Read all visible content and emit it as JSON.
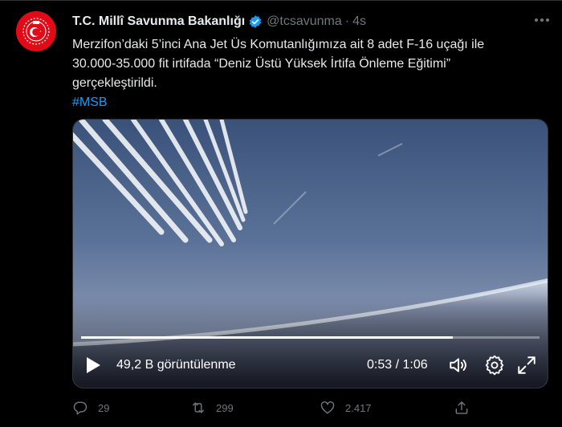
{
  "tweet": {
    "author_name": "T.C. Millî Savunma Bakanlığı",
    "handle": "@tcsavunma",
    "separator": "·",
    "time": "4s",
    "text_lines": [
      "Merzifon’daki 5’inci Ana Jet Üs Komutanlığımıza ait 8 adet F-16 uçağı ile",
      "30.000-35.000 fit irtifada “Deniz Üstü Yüksek İrtifa Önleme Eğitimi”",
      "gerçekleştirildi."
    ],
    "hashtag": "#MSB"
  },
  "video": {
    "views": "49,2 B görüntülenme",
    "time_display": "0:53 / 1:06",
    "progress_fraction": 0.81,
    "icons": [
      "play-icon",
      "volume-icon",
      "settings-icon",
      "fullscreen-icon"
    ]
  },
  "actions": {
    "reply_count": "29",
    "retweet_count": "299",
    "like_count": "2.417",
    "icons": [
      "reply-icon",
      "retweet-icon",
      "like-icon",
      "share-icon"
    ]
  },
  "colors": {
    "background": "#000000",
    "text": "#e7e9ea",
    "muted": "#71767b",
    "accent": "#1d9bf0",
    "avatar_red": "#e30a17"
  }
}
